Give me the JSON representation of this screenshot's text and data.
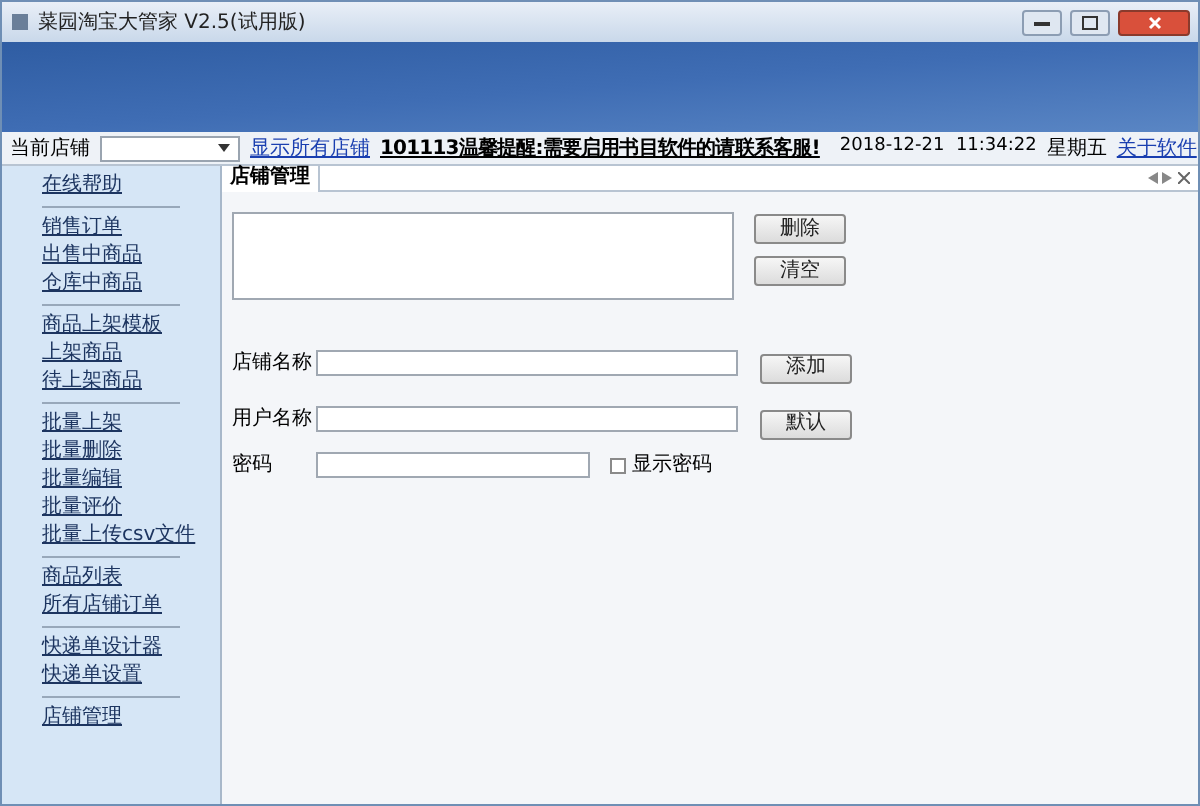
{
  "window": {
    "title": "菜园淘宝大管家 V2.5(试用版)"
  },
  "toolbar": {
    "store_label": "当前店铺",
    "show_all_link": "显示所有店铺",
    "notice": "101113温馨提醒:需要启用书目软件的请联系客服!",
    "datetime": "2018-12-21  11:34:22",
    "weekday": "星期五",
    "about_link": "关于软件"
  },
  "sidebar": {
    "groups": [
      {
        "items": [
          "在线帮助"
        ]
      },
      {
        "items": [
          "销售订单",
          "出售中商品",
          "仓库中商品"
        ]
      },
      {
        "items": [
          "商品上架模板",
          "上架商品",
          "待上架商品"
        ]
      },
      {
        "items": [
          "批量上架",
          "批量删除",
          "批量编辑",
          "批量评价",
          "批量上传csv文件"
        ]
      },
      {
        "items": [
          "商品列表",
          "所有店铺订单"
        ]
      },
      {
        "items": [
          "快递单设计器",
          "快递单设置"
        ]
      },
      {
        "items": [
          "店铺管理"
        ]
      }
    ]
  },
  "tabs": [
    {
      "label": "店铺管理",
      "selected": true
    }
  ],
  "panel": {
    "list_buttons": [
      "删除",
      "清空"
    ],
    "fields": [
      {
        "label": "店铺名称",
        "button": "添加"
      },
      {
        "label": "用户名称",
        "button": "默认"
      },
      {
        "label": "密码",
        "checkbox": {
          "label": "显示密码",
          "checked": false
        }
      }
    ]
  }
}
